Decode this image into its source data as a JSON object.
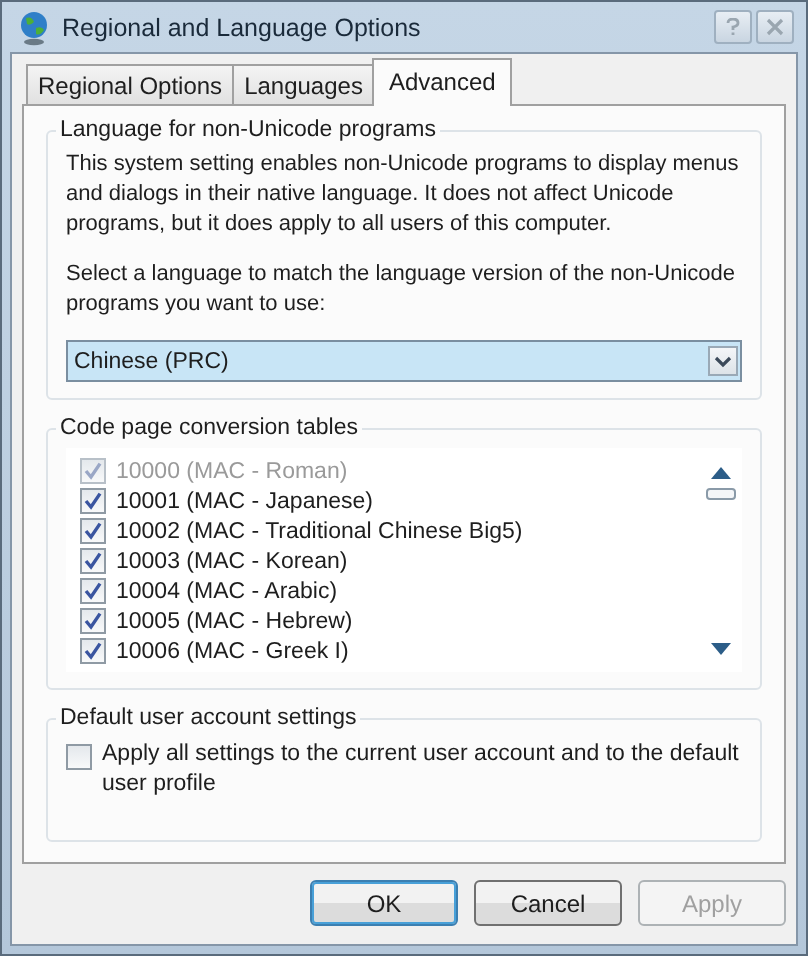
{
  "window": {
    "title": "Regional and Language Options"
  },
  "tabs": [
    {
      "label": "Regional Options",
      "selected": false
    },
    {
      "label": "Languages",
      "selected": false
    },
    {
      "label": "Advanced",
      "selected": true
    }
  ],
  "language_group": {
    "title": "Language for non-Unicode programs",
    "description": "This system setting enables non-Unicode programs to display menus and dialogs in their native language. It does not affect Unicode programs, but it does apply to all users of this computer.",
    "prompt": "Select a language to match the language version of the non-Unicode programs you want to use:",
    "select": {
      "value": "Chinese (PRC)"
    }
  },
  "code_page_group": {
    "title": "Code page conversion tables",
    "items": [
      {
        "label": "10000 (MAC - Roman)",
        "checked": true,
        "disabled": true
      },
      {
        "label": "10001 (MAC - Japanese)",
        "checked": true,
        "disabled": false
      },
      {
        "label": "10002 (MAC - Traditional Chinese Big5)",
        "checked": true,
        "disabled": false
      },
      {
        "label": "10003 (MAC - Korean)",
        "checked": true,
        "disabled": false
      },
      {
        "label": "10004 (MAC - Arabic)",
        "checked": true,
        "disabled": false
      },
      {
        "label": "10005 (MAC - Hebrew)",
        "checked": true,
        "disabled": false
      },
      {
        "label": "10006 (MAC - Greek I)",
        "checked": true,
        "disabled": false
      }
    ]
  },
  "default_user_group": {
    "title": "Default user account settings",
    "option": {
      "label": "Apply all settings to the current user account and to the default user profile",
      "checked": false
    }
  },
  "buttons": [
    {
      "label": "OK",
      "default": true,
      "disabled": false
    },
    {
      "label": "Cancel",
      "default": false,
      "disabled": false
    },
    {
      "label": "Apply",
      "default": false,
      "disabled": true
    }
  ]
}
